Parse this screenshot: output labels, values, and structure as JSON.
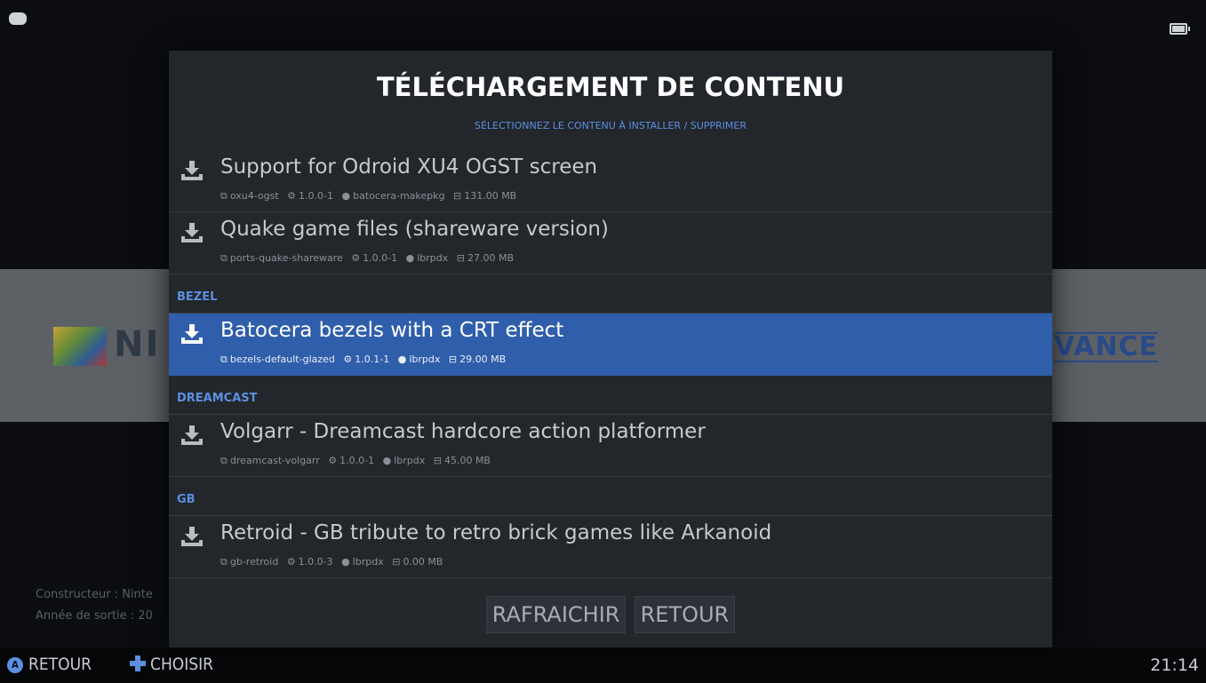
{
  "modal": {
    "title": "TÉLÉCHARGEMENT DE CONTENU",
    "subtitle": "SÉLECTIONNEZ LE CONTENU À INSTALLER / SUPPRIMER"
  },
  "items": [
    {
      "title": "Support for Odroid XU4 OGST screen",
      "package": "oxu4-ogst",
      "version": "1.0.0-1",
      "author": "batocera-makepkg",
      "size": "131.00 MB"
    },
    {
      "title": "Quake game files (shareware version)",
      "package": "ports-quake-shareware",
      "version": "1.0.0-1",
      "author": "lbrpdx",
      "size": "27.00 MB"
    },
    {
      "title": "Batocera bezels with a CRT effect",
      "package": "bezels-default-glazed",
      "version": "1.0.1-1",
      "author": "lbrpdx",
      "size": "29.00 MB"
    },
    {
      "title": "Volgarr - Dreamcast hardcore action platformer",
      "package": "dreamcast-volgarr",
      "version": "1.0.0-1",
      "author": "lbrpdx",
      "size": "45.00 MB"
    },
    {
      "title": "Retroid - GB tribute to retro brick games like Arkanoid",
      "package": "gb-retroid",
      "version": "1.0.0-3",
      "author": "lbrpdx",
      "size": "0.00 MB"
    }
  ],
  "sections": {
    "bezel": "BEZEL",
    "dreamcast": "DREAMCAST",
    "gb": "GB"
  },
  "buttons": {
    "refresh": "RAFRAICHIR",
    "back": "RETOUR"
  },
  "help": {
    "back_label": "RETOUR",
    "choose_label": "CHOISIR",
    "a_glyph": "A"
  },
  "clock": "21:14",
  "background": {
    "left_logo": "NI",
    "right_logo": "VANCE",
    "info_line1": "Constructeur : Ninte",
    "info_line2": "Année de sortie : 20"
  },
  "icons": {
    "download": "download-icon",
    "package": "package-icon",
    "version": "gears-icon",
    "author": "user-icon",
    "size": "disk-icon"
  },
  "colors": {
    "accent": "#5b8fe0",
    "selected_row": "#2f5eaa",
    "modal_bg": "#23272c"
  },
  "battery_level": 1.0
}
